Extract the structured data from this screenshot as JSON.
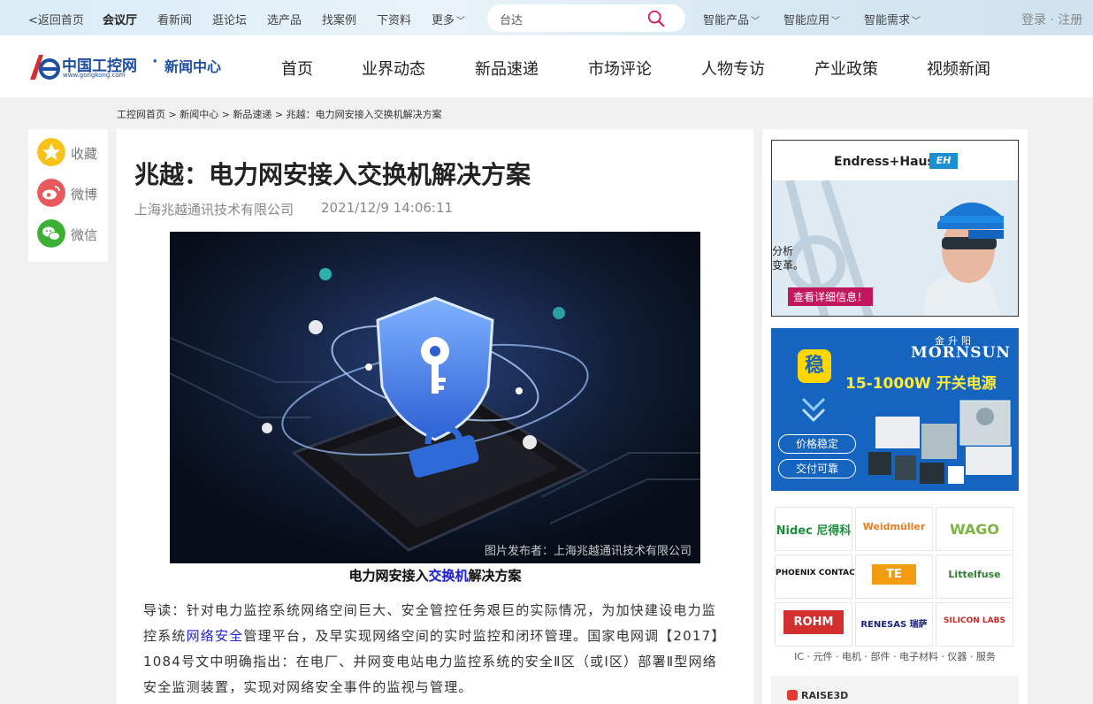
{
  "topbar": {
    "back_home": "<返回首页",
    "links": [
      {
        "label": "会议厅"
      },
      {
        "label": "看新闻"
      },
      {
        "label": "逛论坛"
      },
      {
        "label": "选产品"
      },
      {
        "label": "找案例"
      },
      {
        "label": "下资料"
      }
    ],
    "more": "更多",
    "search": {
      "value": "台达",
      "placeholder": "台达"
    },
    "dropdowns": [
      {
        "label": "智能产品"
      },
      {
        "label": "智能应用"
      },
      {
        "label": "智能需求"
      }
    ],
    "auth": "登录 · 注册"
  },
  "header": {
    "logo_name": "中国工控网",
    "logo_url": "www.gongkong.com",
    "logo_sep": "·",
    "section": "新闻中心",
    "nav": [
      {
        "label": "首页"
      },
      {
        "label": "业界动态"
      },
      {
        "label": "新品速递"
      },
      {
        "label": "市场评论"
      },
      {
        "label": "人物专访"
      },
      {
        "label": "产业政策"
      },
      {
        "label": "视频新闻"
      }
    ]
  },
  "breadcrumb": "工控网首页 > 新闻中心 > 新品速递 > 兆越：电力网安接入交换机解决方案",
  "share": [
    {
      "label": "收藏",
      "icon": "star-icon",
      "color": "#f7c21a"
    },
    {
      "label": "微博",
      "icon": "weibo-icon",
      "color": "#e8585c"
    },
    {
      "label": "微信",
      "icon": "wechat-icon",
      "color": "#3cb034"
    }
  ],
  "article": {
    "title": "兆越：电力网安接入交换机解决方案",
    "source": "上海兆越通讯技术有限公司",
    "date": "2021/12/9 14:06:11",
    "image_credit": "图片发布者：上海兆越通讯技术有限公司",
    "caption_parts": [
      "电力网安接入",
      "交换机",
      "解决方案"
    ],
    "lead_parts": [
      "导读：针对电力监控系统网络空间巨大、安全管控任务艰巨的实际情况，为加快建设电力监控系统",
      "网络安全",
      "管理平台，及早实现网络空间的实时监控和闭环管理。国家电网调【2017】1084号文中明确指出：在电厂、并网变电站电力监控系统的安全Ⅱ区（或Ⅰ区）部署Ⅱ型网络安全监测装置，实现对网络安全事件的监视与管理。"
    ]
  },
  "sidebar": {
    "ad1": {
      "brand": "Endress+Hauser",
      "badge": "EH",
      "text_lines": [
        "分析",
        "变革。"
      ],
      "cta": "查看详细信息！"
    },
    "ad2": {
      "brand_cn": "金升阳",
      "brand_en": "MORNSUN",
      "badge": "稳",
      "headline": "15-1000W 开关电源",
      "pills": [
        "价格稳定",
        "交付可靠"
      ]
    },
    "brands": [
      {
        "name": "Nidec 尼得科",
        "color": "#1b8f3a"
      },
      {
        "name": "Weidmüller",
        "color": "#e67e22"
      },
      {
        "name": "WAGO",
        "color": "#7cb342"
      },
      {
        "name": "PHOENIX CONTACT",
        "color": "#111111"
      },
      {
        "name": "TE",
        "color": "#f39c12"
      },
      {
        "name": "Littelfuse",
        "color": "#2e7d32"
      },
      {
        "name": "ROHM",
        "color": "#d32f2f"
      },
      {
        "name": "RENESAS 瑞萨",
        "color": "#1a237e"
      },
      {
        "name": "SILICON LABS",
        "color": "#c62828"
      }
    ],
    "brand_caption": "IC · 元件 · 电机 · 部件 · 电子材料 · 仪器 · 服务",
    "ad3": {
      "label": "RAISE3D"
    }
  }
}
